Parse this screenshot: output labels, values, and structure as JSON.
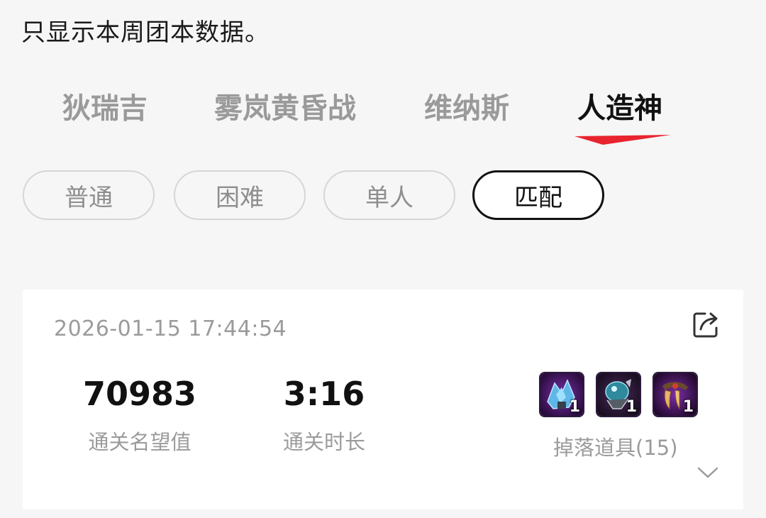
{
  "notice": "只显示本周团本数据。",
  "raid_tabs": [
    {
      "label": "狄瑞吉",
      "active": false
    },
    {
      "label": "雾岚黄昏战",
      "active": false
    },
    {
      "label": "维纳斯",
      "active": false
    },
    {
      "label": "人造神",
      "active": true
    }
  ],
  "difficulty_chips": [
    {
      "label": "普通",
      "active": false
    },
    {
      "label": "困难",
      "active": false
    },
    {
      "label": "单人",
      "active": false
    },
    {
      "label": "匹配",
      "active": true
    }
  ],
  "record": {
    "timestamp": "2026-01-15 17:44:54",
    "score_value": "70983",
    "score_label": "通关名望值",
    "duration_value": "3:16",
    "duration_label": "通关时长",
    "drops": [
      {
        "icon": "blue-crystal-item-icon",
        "count": "1"
      },
      {
        "icon": "teal-armor-item-icon",
        "count": "1"
      },
      {
        "icon": "gold-claw-item-icon",
        "count": "1"
      }
    ],
    "drops_label": "掉落道具(15)"
  },
  "colors": {
    "accent_red": "#e8242f",
    "active_text": "#111111",
    "inactive_text": "#9a9a9a"
  },
  "icons": {
    "share": "share-icon",
    "expand": "chevron-down-icon"
  }
}
